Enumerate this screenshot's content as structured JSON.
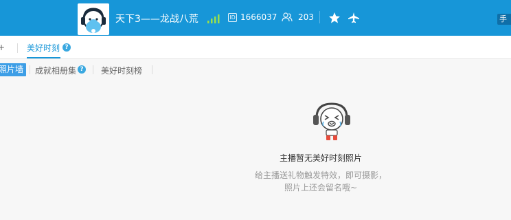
{
  "header": {
    "title": "天下3——龙战八荒",
    "signal_icon": "signal-bars-icon",
    "id_icon_text": "ID",
    "room_id": "1666037",
    "fans_icon": "users-icon",
    "fans_count": "203",
    "star_icon": "star-icon",
    "plane_icon": "plane-icon",
    "tag_text": "手",
    "colors": {
      "background": "#1796d8",
      "signal": "#9be04a"
    }
  },
  "tabs": {
    "edge_label": "+",
    "active_label": "美好时刻",
    "help_text": "?"
  },
  "subtabs": {
    "active_label": "照片墙",
    "items": [
      {
        "label": "成就相册集",
        "help": "?"
      },
      {
        "label": "美好时刻榜"
      }
    ],
    "colors": {
      "active_bg": "#3d9ee6"
    }
  },
  "empty_state": {
    "icon": "crying-mascot-headphones-icon",
    "title": "主播暂无美好时刻照片",
    "desc_line1": "给主播送礼物触发特效，即可摄影，",
    "desc_line2": "照片上还会留名哦~"
  }
}
